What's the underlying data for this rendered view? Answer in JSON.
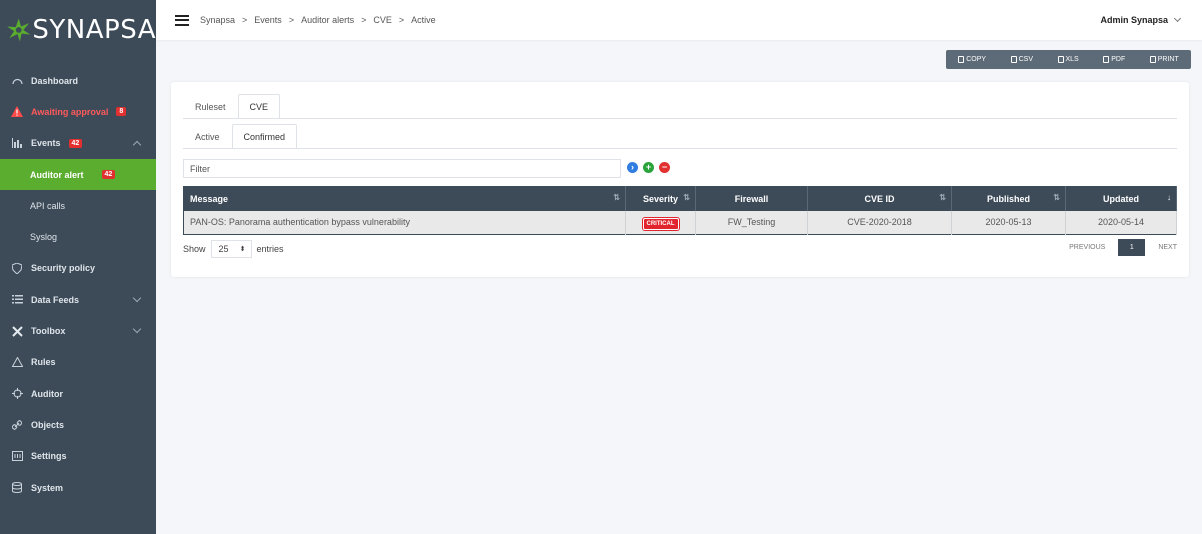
{
  "brand": {
    "name": "SYNAPSA",
    "accent": "#5aad2e",
    "sidebar_bg": "#3d4b59"
  },
  "sidebar": {
    "items": [
      {
        "label": "Dashboard",
        "icon": "dashboard-icon"
      },
      {
        "label": "Awaiting approval",
        "icon": "warning-icon",
        "badge": "8"
      },
      {
        "label": "Events",
        "icon": "chart-icon",
        "badge": "42"
      },
      {
        "label": "Auditor alert",
        "badge": "42"
      },
      {
        "label": "API calls"
      },
      {
        "label": "Syslog"
      },
      {
        "label": "Security policy",
        "icon": "shield-icon"
      },
      {
        "label": "Data Feeds",
        "icon": "list-icon"
      },
      {
        "label": "Toolbox",
        "icon": "tools-icon"
      },
      {
        "label": "Rules",
        "icon": "triangle-icon"
      },
      {
        "label": "Auditor",
        "icon": "crosshair-icon"
      },
      {
        "label": "Objects",
        "icon": "link-icon"
      },
      {
        "label": "Settings",
        "icon": "settings-icon"
      },
      {
        "label": "System",
        "icon": "database-icon"
      }
    ]
  },
  "header": {
    "breadcrumb": [
      "Synapsa",
      "Events",
      "Auditor alerts",
      "CVE",
      "Active"
    ],
    "separator": ">",
    "user": "Admin Synapsa"
  },
  "exports": [
    "COPY",
    "CSV",
    "XLS",
    "PDF",
    "PRINT"
  ],
  "tabs_top": [
    "Ruleset",
    "CVE"
  ],
  "tabs_sub": [
    "Active",
    "Confirmed"
  ],
  "filter": {
    "placeholder": "Filter"
  },
  "table": {
    "columns": [
      "Message",
      "Severity",
      "Firewall",
      "CVE ID",
      "Published",
      "Updated"
    ],
    "rows": [
      {
        "message": "PAN-OS: Panorama authentication bypass vulnerability",
        "severity": "CRITICAL",
        "firewall": "FW_Testing",
        "cve_id": "CVE-2020-2018",
        "published": "2020-05-13",
        "updated": "2020-05-14"
      }
    ]
  },
  "pagination": {
    "show_label": "Show",
    "page_size": "25",
    "entries_label": "entries",
    "previous": "PREVIOUS",
    "current": "1",
    "next": "NEXT"
  }
}
